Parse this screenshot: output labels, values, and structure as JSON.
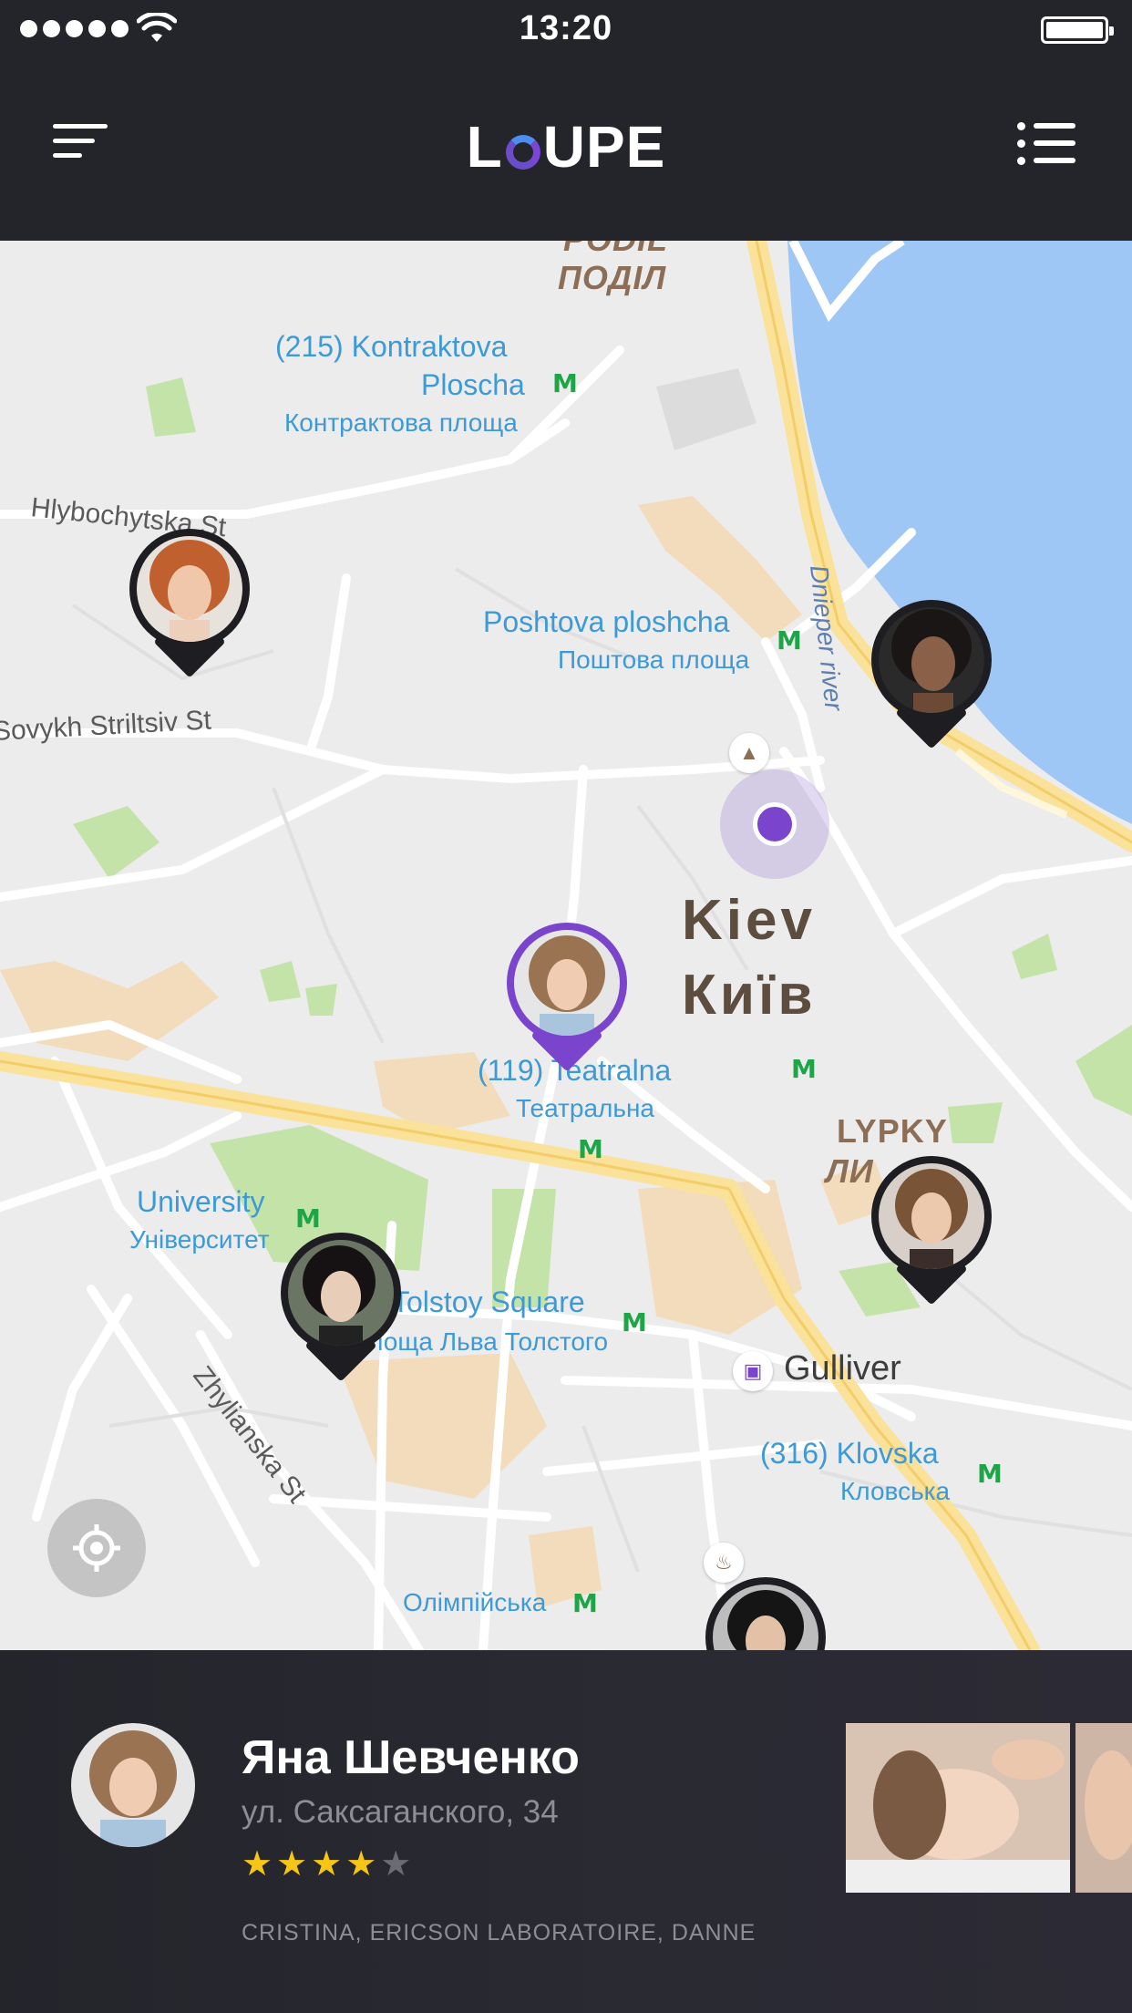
{
  "status_bar": {
    "time": "13:20",
    "signal_dots": 5,
    "wifi_icon": "wifi-icon",
    "battery_icon": "battery-full-icon"
  },
  "navbar": {
    "menu_icon": "filter-menu-icon",
    "logo": "LOUPE",
    "list_icon": "list-view-icon"
  },
  "map": {
    "labels": {
      "podil_en": "PODIL",
      "podil": "ПОДІЛ",
      "kontraktova_1": "(215) Kontraktova",
      "kontraktova_2": "Ploscha",
      "kontraktova_ua": "Контрактова площа",
      "hlybochytska": "Hlybochytska St",
      "poshtova": "Poshtova ploshcha",
      "poshtova_ua": "Поштова площа",
      "sovykh": "Sovykh Striltsiv St",
      "dnieper": "Dnieper river",
      "kiev": "Kiev",
      "kyiv": "Київ",
      "teatralna": "(119) Teatralna",
      "teatralna_ua": "Театральна",
      "lypky": "LYPKY",
      "lypky_ua": "ЛИ",
      "university": "University",
      "university_ua": "Університет",
      "tolstoy": "Tolstoy Square",
      "tolstoy_ua": "Площа Льва Толстого",
      "gulliver": "Gulliver",
      "klovska": "(316) Klovska",
      "klovska_ua": "Кловська",
      "zhylianska": "Zhylianska St",
      "olimpiyska": "Олімпійська"
    },
    "metro_symbol": "M",
    "pins": [
      {
        "name": "specialist-pin-1",
        "active": false
      },
      {
        "name": "specialist-pin-2",
        "active": false
      },
      {
        "name": "specialist-pin-3",
        "active": true
      },
      {
        "name": "specialist-pin-4",
        "active": false
      },
      {
        "name": "specialist-pin-5",
        "active": false
      },
      {
        "name": "specialist-pin-6",
        "active": false
      }
    ],
    "locate_icon": "crosshair-icon",
    "accent_color": "#7a45cc"
  },
  "card": {
    "name": "Яна Шевченко",
    "address": "ул. Саксаганского, 34",
    "rating": 4,
    "rating_max": 5,
    "stars_on": "★★★★",
    "stars_off": "★",
    "brands": "CRISTINA, ERICSON LABORATOIRE, DANNE"
  },
  "colors": {
    "background": "#24252b",
    "accent": "#7a45cc",
    "star": "#f5c518"
  }
}
